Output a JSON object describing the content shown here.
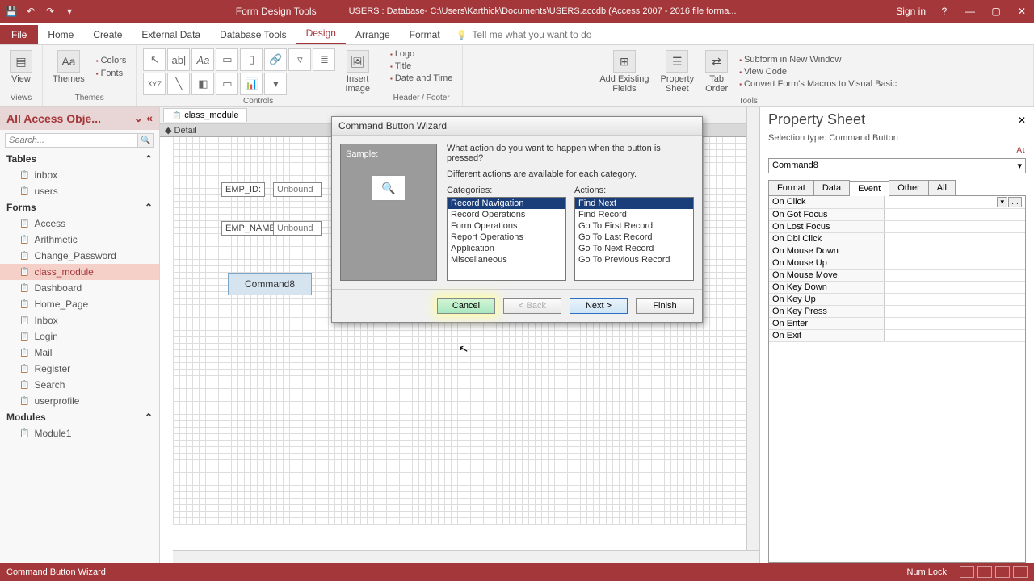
{
  "titlebar": {
    "context": "Form Design Tools",
    "db": "USERS : Database- C:\\Users\\Karthick\\Documents\\USERS.accdb (Access 2007 - 2016 file forma...",
    "signin": "Sign in"
  },
  "tabs": {
    "file": "File",
    "items": [
      "Home",
      "Create",
      "External Data",
      "Database Tools",
      "Design",
      "Arrange",
      "Format"
    ],
    "active": "Design",
    "tellme": "Tell me what you want to do"
  },
  "ribbon": {
    "views": {
      "label": "Views",
      "view": "View"
    },
    "themes": {
      "label": "Themes",
      "themes": "Themes",
      "colors": "Colors",
      "fonts": "Fonts"
    },
    "controls": {
      "label": "Controls",
      "insert": "Insert\nImage"
    },
    "headerfooter": {
      "label": "Header / Footer",
      "logo": "Logo",
      "title": "Title",
      "datetime": "Date and Time"
    },
    "tools": {
      "label": "Tools",
      "addfields": "Add Existing\nFields",
      "propsheet": "Property\nSheet",
      "taborder": "Tab\nOrder",
      "subform": "Subform in New Window",
      "viewcode": "View Code",
      "convert": "Convert Form's Macros to Visual Basic"
    }
  },
  "nav": {
    "header": "All Access Obje...",
    "search_ph": "Search...",
    "cats": {
      "tables": "Tables",
      "forms": "Forms",
      "modules": "Modules"
    },
    "tables": [
      "inbox",
      "users"
    ],
    "forms": [
      "Access",
      "Arithmetic",
      "Change_Password",
      "class_module",
      "Dashboard",
      "Home_Page",
      "Inbox",
      "Login",
      "Mail",
      "Register",
      "Search",
      "userprofile"
    ],
    "forms_selected": "class_module",
    "modules": [
      "Module1"
    ]
  },
  "canvas": {
    "tab": "class_module",
    "section": "Detail",
    "fields": {
      "lab1": "EMP_ID:",
      "val1": "Unbound",
      "lab2": "EMP_NAME:",
      "val2": "Unbound",
      "btn": "Command8"
    }
  },
  "wizard": {
    "title": "Command Button Wizard",
    "sample": "Sample:",
    "q1": "What action do you want to happen when the button is pressed?",
    "q2": "Different actions are available for each category.",
    "cat_label": "Categories:",
    "act_label": "Actions:",
    "categories": [
      "Record Navigation",
      "Record Operations",
      "Form Operations",
      "Report Operations",
      "Application",
      "Miscellaneous"
    ],
    "cat_selected": "Record Navigation",
    "actions": [
      "Find Next",
      "Find Record",
      "Go To First Record",
      "Go To Last Record",
      "Go To Next Record",
      "Go To Previous Record"
    ],
    "act_selected": "Find Next",
    "btns": {
      "cancel": "Cancel",
      "back": "< Back",
      "next": "Next >",
      "finish": "Finish"
    }
  },
  "propsheet": {
    "title": "Property Sheet",
    "subtitle": "Selection type:  Command Button",
    "combo": "Command8",
    "tabs": [
      "Format",
      "Data",
      "Event",
      "Other",
      "All"
    ],
    "tab_active": "Event",
    "events": [
      "On Click",
      "On Got Focus",
      "On Lost Focus",
      "On Dbl Click",
      "On Mouse Down",
      "On Mouse Up",
      "On Mouse Move",
      "On Key Down",
      "On Key Up",
      "On Key Press",
      "On Enter",
      "On Exit"
    ]
  },
  "status": {
    "text": "Command Button Wizard",
    "numlock": "Num Lock"
  }
}
